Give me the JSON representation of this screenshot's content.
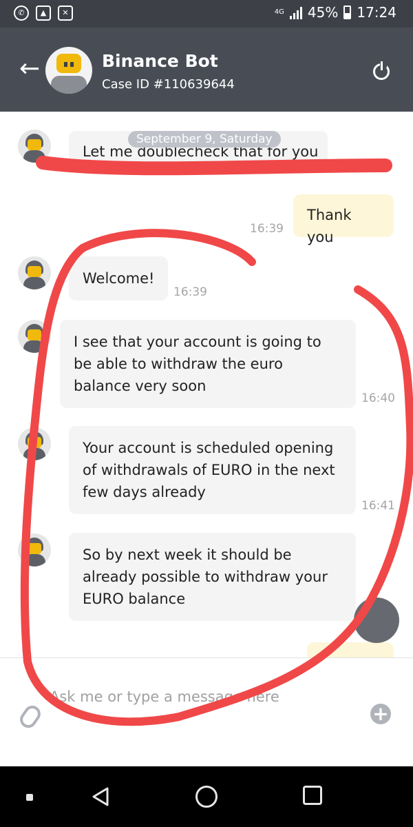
{
  "status_bar": {
    "network": "4G",
    "battery": "45%",
    "time": "17:24"
  },
  "header": {
    "title": "Binance Bot",
    "case_id": "Case ID #110639644"
  },
  "chat": {
    "date_separator": "September 9, Saturday",
    "messages": [
      {
        "direction": "in",
        "text": "Let me doublecheck that for you",
        "time": ""
      },
      {
        "direction": "out",
        "text": "Thank you",
        "time": "16:39"
      },
      {
        "direction": "in",
        "text": "Welcome!",
        "time": "16:39"
      },
      {
        "direction": "in",
        "text": "I see that your account is going to be able to withdraw the euro balance very soon",
        "time": "16:40"
      },
      {
        "direction": "in",
        "text": "Your account is scheduled opening of withdrawals of EURO in the next few days already",
        "time": "16:41"
      },
      {
        "direction": "in",
        "text": "So by next week it should be already possible to withdraw your EURO balance",
        "time": ""
      }
    ]
  },
  "composer": {
    "placeholder": "Ask me or type a message here"
  },
  "colors": {
    "header_bg": "#484d55",
    "status_bar_bg": "#3d4147",
    "brand_yellow": "#f0b90b",
    "incoming_bubble": "#f4f4f4",
    "outgoing_bubble": "#fdf6d8",
    "annotation_red": "#f04848"
  },
  "icons": {
    "back": "arrow-left-icon",
    "power": "power-icon",
    "attach": "paperclip-icon",
    "add": "plus-circle-icon"
  }
}
